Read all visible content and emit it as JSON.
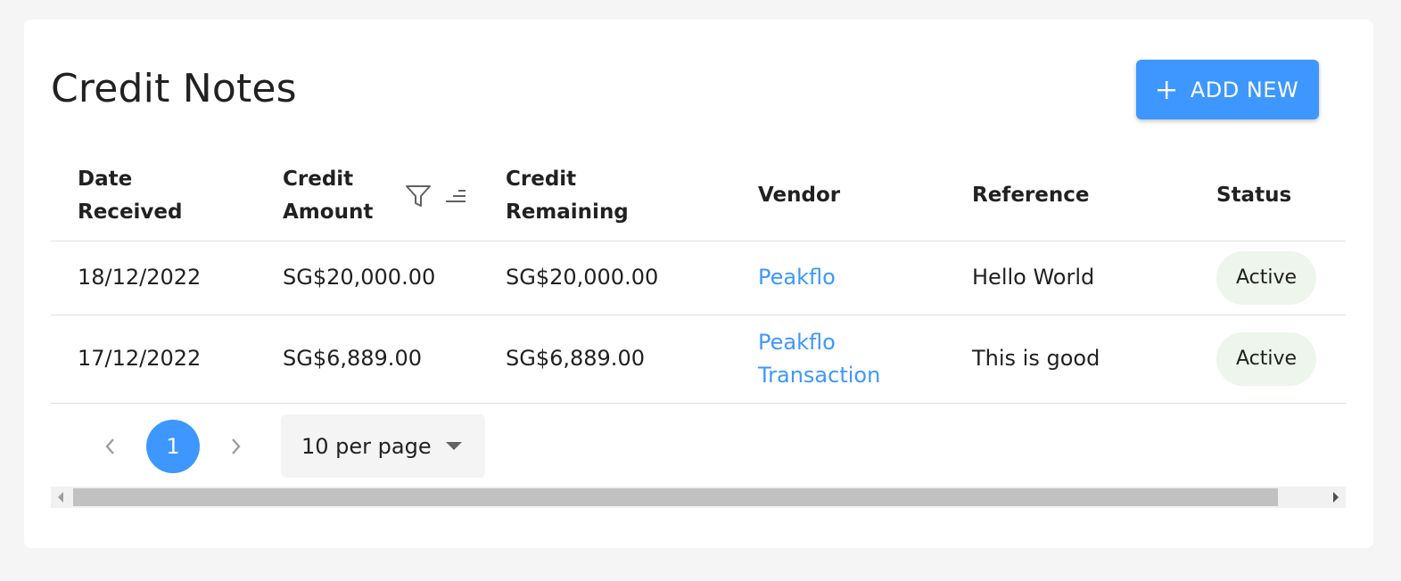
{
  "page": {
    "title": "Credit Notes",
    "add_button_label": "ADD NEW"
  },
  "table": {
    "columns": {
      "date_received_line1": "Date",
      "date_received_line2": "Received",
      "credit_amount_line1": "Credit",
      "credit_amount_line2": "Amount",
      "credit_remaining_line1": "Credit",
      "credit_remaining_line2": "Remaining",
      "vendor": "Vendor",
      "reference": "Reference",
      "status": "Status"
    },
    "rows": [
      {
        "date_received": "18/12/2022",
        "credit_amount": "SG$20,000.00",
        "credit_remaining": "SG$20,000.00",
        "vendor_line1": "Peakflo",
        "vendor_line2": "",
        "reference": "Hello World",
        "status": "Active"
      },
      {
        "date_received": "17/12/2022",
        "credit_amount": "SG$6,889.00",
        "credit_remaining": "SG$6,889.00",
        "vendor_line1": "Peakflo",
        "vendor_line2": "Transaction",
        "reference": "This is good",
        "status": "Active"
      }
    ]
  },
  "pagination": {
    "current_page": "1",
    "per_page_label": "10 per page"
  },
  "icons": {
    "add": "plus-icon",
    "filter": "filter-icon",
    "sort": "sort-icon",
    "prev": "chevron-left-icon",
    "next": "chevron-right-icon",
    "dropdown": "caret-down-icon"
  },
  "colors": {
    "accent": "#3d97ff",
    "status_bg": "#eef5ec",
    "page_bg": "#f5f5f5"
  }
}
